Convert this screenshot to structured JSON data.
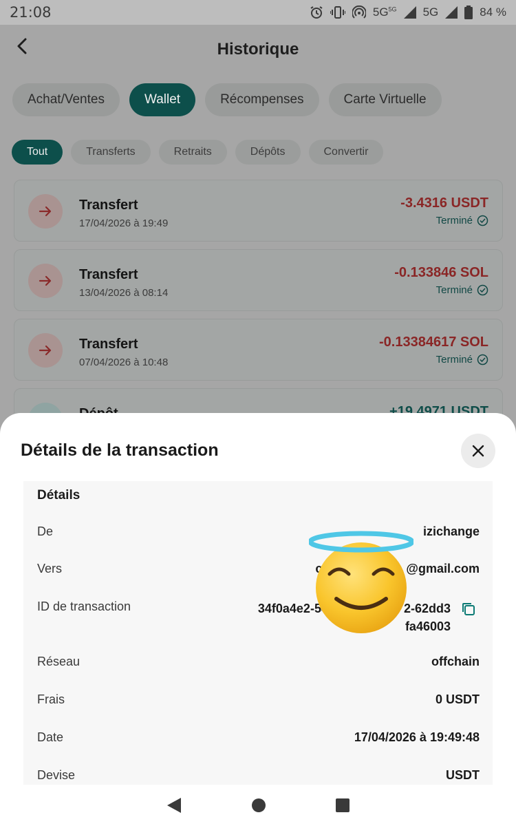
{
  "status_bar": {
    "time": "21:08",
    "network_1": "5G",
    "network_1_super": "5G",
    "network_2": "5G",
    "battery": "84 %"
  },
  "header": {
    "title": "Historique"
  },
  "tabs": [
    {
      "label": "Achat/Ventes",
      "active": false
    },
    {
      "label": "Wallet",
      "active": true
    },
    {
      "label": "Récompenses",
      "active": false
    },
    {
      "label": "Carte Virtuelle",
      "active": false
    }
  ],
  "filters": [
    {
      "label": "Tout",
      "active": true
    },
    {
      "label": "Transferts",
      "active": false
    },
    {
      "label": "Retraits",
      "active": false
    },
    {
      "label": "Dépôts",
      "active": false
    },
    {
      "label": "Convertir",
      "active": false
    }
  ],
  "transactions": [
    {
      "name": "Transfert",
      "date": "17/04/2026 à 19:49",
      "amount": "-3.4316 USDT",
      "status": "Terminé"
    },
    {
      "name": "Transfert",
      "date": "13/04/2026 à 08:14",
      "amount": "-0.133846 SOL",
      "status": "Terminé"
    },
    {
      "name": "Transfert",
      "date": "07/04/2026 à 10:48",
      "amount": "-0.13384617 SOL",
      "status": "Terminé"
    },
    {
      "name": "Dépôt",
      "amount": "+19.4971 USDT"
    }
  ],
  "sheet": {
    "title": "Détails de la transaction",
    "heading": "Détails",
    "rows": {
      "from": {
        "label": "De",
        "value": "izichange"
      },
      "to": {
        "label": "Vers",
        "value_start": "c",
        "value_end": "@gmail.com"
      },
      "txid": {
        "label": "ID de transaction",
        "line1_start": "34f0a4e2-54",
        "line1_end": "2-62dd3",
        "line2": "fa46003"
      },
      "network": {
        "label": "Réseau",
        "value": "offchain"
      },
      "fee": {
        "label": "Frais",
        "value": "0 USDT"
      },
      "date": {
        "label": "Date",
        "value": "17/04/2026 à 19:49:48"
      },
      "currency": {
        "label": "Devise",
        "value": "USDT"
      }
    }
  },
  "colors": {
    "accent": "#0d4f4b",
    "negative_amount": "#8a2626",
    "positive_amount": "#0f4d49",
    "copy_icon": "#0b7a74"
  },
  "icons": [
    "alarm-icon",
    "vibrate-icon",
    "hotspot-icon",
    "signal-icon",
    "battery-icon",
    "back-arrow-icon",
    "arrow-right-icon",
    "check-circle-icon",
    "close-icon",
    "copy-icon",
    "smiling-face-with-halo-emoji",
    "nav-back-icon",
    "nav-home-icon",
    "nav-recents-icon"
  ]
}
